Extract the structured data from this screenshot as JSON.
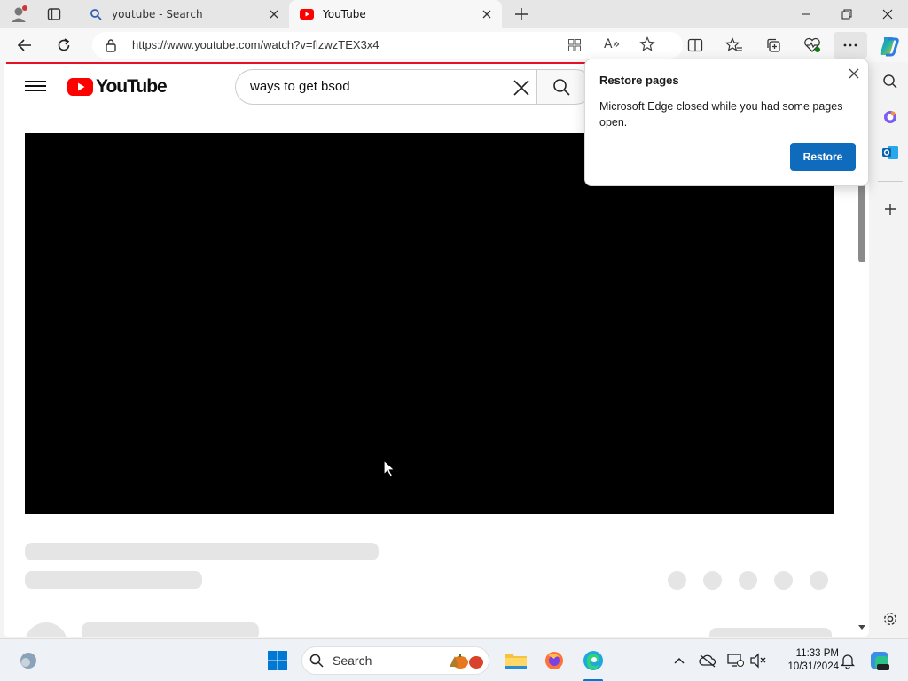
{
  "browser": {
    "tabs": [
      {
        "title": "youtube - Search",
        "icon": "search-icon",
        "active": false
      },
      {
        "title": "YouTube",
        "icon": "youtube-favicon",
        "active": true
      }
    ],
    "url": "https://www.youtube.com/watch?v=flzwzTEX3x4"
  },
  "youtube": {
    "logo_text": "YouTube",
    "search_query": "ways to get bsod"
  },
  "popup": {
    "title": "Restore pages",
    "message": "Microsoft Edge closed while you had some pages open.",
    "button": "Restore"
  },
  "taskbar": {
    "search_label": "Search",
    "time": "11:33 PM",
    "date": "10/31/2024"
  },
  "colors": {
    "accent": "#0f6cbd",
    "youtube_red": "#ff0000",
    "loading_line": "#e81123"
  }
}
